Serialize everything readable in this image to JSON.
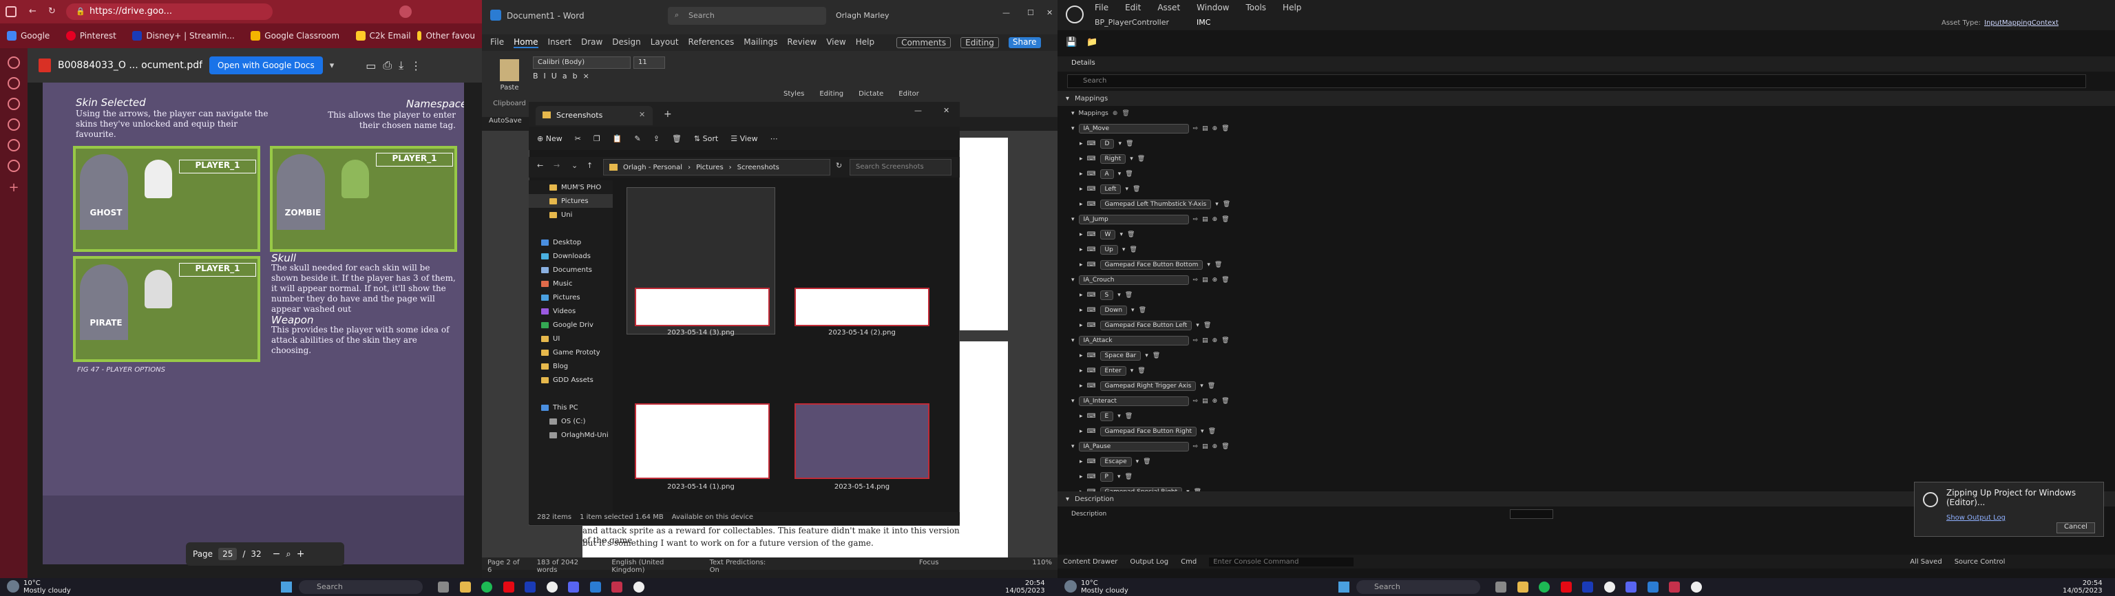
{
  "browser": {
    "url": "https://drive.goo...",
    "bookmarks": [
      "Google",
      "Pinterest",
      "Disney+ | Streamin...",
      "Google Classroom",
      "C2k Email",
      "Other favou"
    ],
    "pdf_title": "B00884033_O ... ocument.pdf",
    "open_with": "Open with Google Docs",
    "page_label": "Page",
    "page_current": "25",
    "page_sep": "/",
    "page_total": "32",
    "content": {
      "skin_selected_title": "Skin Selected",
      "skin_selected_text": "Using the arrows, the player can navigate the skins they've unlocked and equip their favourite.",
      "namespace_title": "Namespace",
      "namespace_text": "This allows the player to enter their chosen name tag.",
      "skull_title": "Skull",
      "skull_text": "The skull needed for each skin will be shown beside it. If the player has 3 of them, it will appear normal. If not, it'll show the number they do have and the page will appear washed out",
      "weapon_title": "Weapon",
      "weapon_text": "This provides the player with some idea of attack abilities of the skin they are choosing.",
      "caption": "FIG 47 - PLAYER OPTIONS",
      "card_labels": [
        "GHOST",
        "ZOMBIE",
        "PIRATE"
      ],
      "player_label": "PLAYER_1"
    }
  },
  "word": {
    "title": "Document1 - Word",
    "search": "Search",
    "user": "Orlagh Marley",
    "tabs": [
      "File",
      "Home",
      "Insert",
      "Draw",
      "Design",
      "Layout",
      "References",
      "Mailings",
      "Review",
      "View",
      "Help"
    ],
    "comments": "Comments",
    "editing": "Editing",
    "share": "Share",
    "font": "Calibri (Body)",
    "size": "11",
    "groups": [
      "Paste",
      "Clipboard",
      "Styles",
      "Editing",
      "Dictate",
      "Editor"
    ],
    "autosave": "AutoSave",
    "body_lines": [
      "and attack sprite as a reward for collectables. This feature didn't make it into this version of the game",
      "but it's something I want to work on for a future version of the game."
    ],
    "status": [
      "Page 2 of 6",
      "183 of 2042 words",
      "English (United Kingdom)",
      "Text Predictions: On",
      "Focus",
      "110%"
    ]
  },
  "explorer": {
    "tab": "Screenshots",
    "toolbar": [
      "New",
      "Sort",
      "View"
    ],
    "breadcrumb": [
      "Orlagh - Personal",
      "Pictures",
      "Screenshots"
    ],
    "search_placeholder": "Search Screenshots",
    "nav": [
      "MUM'S PHO",
      "Pictures",
      "Uni",
      "Desktop",
      "Downloads",
      "Documents",
      "Music",
      "Pictures",
      "Videos",
      "Google Driv",
      "UI",
      "Game Prototy",
      "Blog",
      "GDD Assets",
      "This PC",
      "OS (C:)",
      "OrlaghMd-Uni"
    ],
    "files": [
      "2023-05-14 (3).png",
      "2023-05-14 (2).png",
      "2023-05-14 (1).png",
      "2023-05-14.png"
    ],
    "status": [
      "282 items",
      "1 item selected  1.64 MB",
      "Available on this device"
    ]
  },
  "unreal": {
    "menu": [
      "File",
      "Edit",
      "Asset",
      "Window",
      "Tools",
      "Help"
    ],
    "tabs": [
      "BP_PlayerController",
      "IMC"
    ],
    "asset_type_label": "Asset Type:",
    "asset_type": "InputMappingContext",
    "details": "Details",
    "search": "Search",
    "section_mappings": "Mappings",
    "mappings_label": "Mappings",
    "actions": [
      {
        "name": "IA_Move",
        "keys": [
          "D",
          "Right",
          "A",
          "Left",
          "Gamepad Left Thumbstick Y-Axis"
        ]
      },
      {
        "name": "IA_Jump",
        "keys": [
          "W",
          "Up",
          "Gamepad Face Button Bottom"
        ]
      },
      {
        "name": "IA_Crouch",
        "keys": [
          "S",
          "Down",
          "Gamepad Face Button Left"
        ]
      },
      {
        "name": "IA_Attack",
        "keys": [
          "Space Bar",
          "Enter",
          "Gamepad Right Trigger Axis"
        ]
      },
      {
        "name": "IA_Interact",
        "keys": [
          "E",
          "Gamepad Face Button Right"
        ]
      },
      {
        "name": "IA_Pause",
        "keys": [
          "Escape",
          "P",
          "Gamepad Special Right"
        ]
      }
    ],
    "section_description": "Description",
    "description_label": "Description",
    "toast_title": "Zipping Up Project for Windows (Editor)...",
    "toast_link": "Show Output Log",
    "toast_cancel": "Cancel",
    "bottom": [
      "Content Drawer",
      "Output Log",
      "Cmd",
      "Enter Console Command",
      "All Saved",
      "Source Control"
    ]
  },
  "taskbar": {
    "weather_temp": "10°C",
    "weather_desc": "Mostly cloudy",
    "search": "Search",
    "time": "20:54",
    "date": "14/05/2023"
  },
  "colors": {
    "accent": "#8b1d2c",
    "page": "#5a4e72",
    "card": "#98c947",
    "file_border": "#c12b37"
  }
}
